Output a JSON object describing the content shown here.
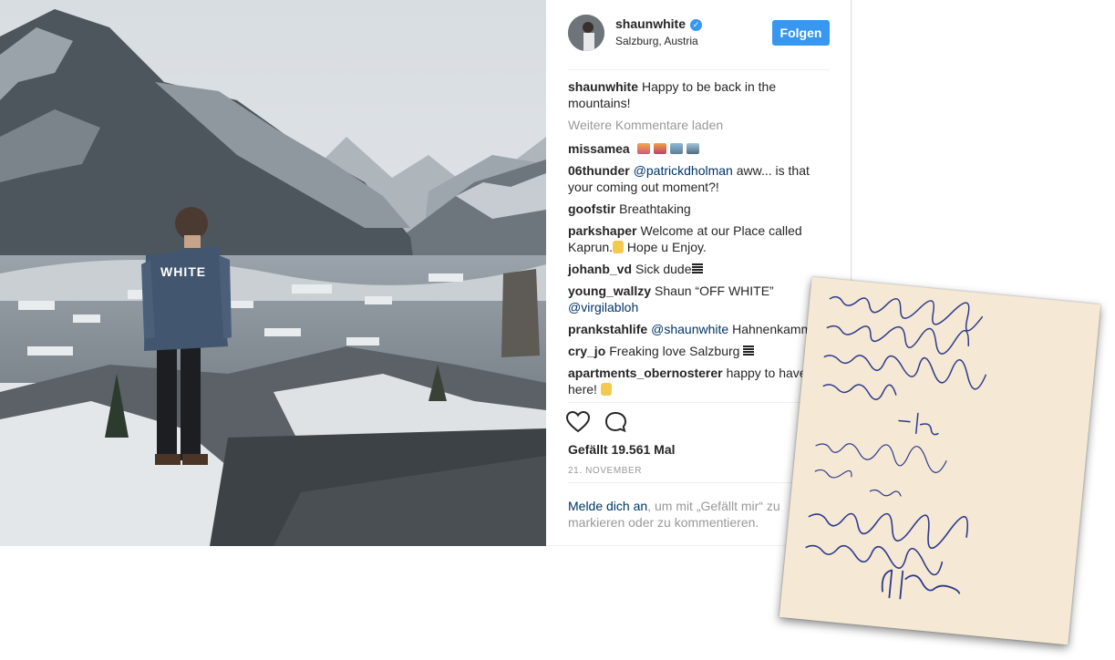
{
  "post": {
    "username": "shaunwhite",
    "location": "Salzburg, Austria",
    "follow_label": "Folgen",
    "caption": "Happy to be back in the mountains!",
    "load_more": "Weitere Kommentare laden",
    "comments": [
      {
        "user": "missamea",
        "text": ""
      },
      {
        "user": "06thunder",
        "mention": "@patrickdholman",
        "text": " aww... is that your coming out moment?!"
      },
      {
        "user": "goofstir",
        "text": "Breathtaking"
      },
      {
        "user": "parkshaper",
        "text": "Welcome at our Place called Kaprun.",
        "text2": " Hope u Enjoy."
      },
      {
        "user": "johanb_vd",
        "text": "Sick dude"
      },
      {
        "user": "young_wallzy",
        "text": "Shaun “OFF WHITE”",
        "mention": "@virgilabloh"
      },
      {
        "user": "prankstahlife",
        "mention": "@shaunwhite",
        "text": " Hahnenkamm"
      },
      {
        "user": "cry_jo",
        "text": "Freaking love Salzburg"
      },
      {
        "user": "apartments_obernosterer",
        "text": "happy to have you here!"
      }
    ],
    "likes": "Gefällt 19.561 Mal",
    "date": "21. NOVEMBER",
    "login_link": "Melde dich an",
    "login_text": ", um mit „Gefällt mir“ zu markieren oder zu kommentieren.",
    "icons": {
      "like": "heart-icon",
      "comment": "comment-bubble-icon",
      "verified": "verified-badge-icon"
    }
  },
  "photo": {
    "jacket_text": "WHITE"
  },
  "note": {
    "lines": [
      "Thank You So much for",
      "letting us stay at Your",
      "home! This Place is Amazing!",
      "Your the best.",
      "-Toby",
      "Thanks for the Awesome",
      "Place!",
      "Shaun",
      "Thank you guys so so much!",
      "I can't wait to come back."
    ]
  },
  "colors": {
    "accent": "#3897f0",
    "link": "#003569",
    "muted": "#999999",
    "note_paper": "#f5e8d4",
    "ink": "#2d3a8c"
  }
}
